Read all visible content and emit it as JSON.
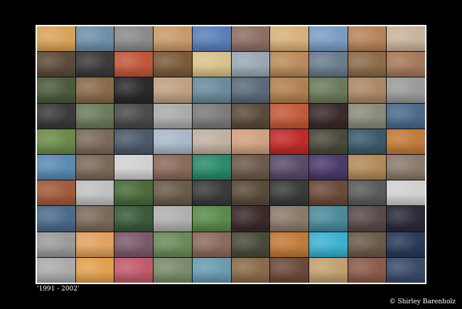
{
  "caption": {
    "years": "'1991 - 2002'",
    "copyright": "© Shirley Barenholz"
  },
  "mosaic": {
    "rows": 10,
    "columns": 10,
    "tile_colors": [
      "#d9a25a",
      "#6f8fa8",
      "#8a8a8a",
      "#c89a6b",
      "#5a7fb8",
      "#8d6e63",
      "#d6b07a",
      "#7a9cc2",
      "#b5835a",
      "#c7b39a",
      "#5b4a3a",
      "#3a3a3a",
      "#c0573a",
      "#7a5a3a",
      "#d8c08a",
      "#9aa7b3",
      "#b88a5a",
      "#6a7b8c",
      "#8c6a4a",
      "#a5785a",
      "#4a5a3a",
      "#8a6a4a",
      "#2a2a2a",
      "#c0a080",
      "#6a8a9a",
      "#5a6a7a",
      "#b08050",
      "#6a7a5a",
      "#aa8866",
      "#9a9a9a",
      "#3a3a3a",
      "#6a7a5a",
      "#4a4a4a",
      "#aaaaaa",
      "#7a7a7a",
      "#5a4a3a",
      "#c05a3a",
      "#3a2a2a",
      "#8a8a7a",
      "#4a6a8a",
      "#6a8a4a",
      "#7a6a5a",
      "#4a5a6a",
      "#a8b8c8",
      "#c0b0a0",
      "#d0a080",
      "#c02a2a",
      "#4a4a3a",
      "#3a5a6a",
      "#c07a3a",
      "#5a8ab0",
      "#7a6a5a",
      "#d0d0d0",
      "#8a6a5a",
      "#2a8a6a",
      "#6a5a4a",
      "#5a4a6a",
      "#4a3a6a",
      "#b08a5a",
      "#8a7a6a",
      "#a05a3a",
      "#c0c0c0",
      "#4a6a3a",
      "#6a5a4a",
      "#3a3a3a",
      "#5a4a3a",
      "#3a3a3a",
      "#6a4a3a",
      "#5a5a5a",
      "#d0d0d0",
      "#4a6a8a",
      "#7a6a5a",
      "#3a5a3a",
      "#b0b0b0",
      "#5a8a4a",
      "#3a2a2a",
      "#8a7a6a",
      "#4a8a9a",
      "#5a4a4a",
      "#2a2a3a",
      "#9a9a9a",
      "#e0a060",
      "#7a5a6a",
      "#6a8a5a",
      "#8a6a5a",
      "#4a4a3a",
      "#c07a3a",
      "#3ab0d0",
      "#6a5a4a",
      "#2a3a5a",
      "#aaaaaa",
      "#e0a050",
      "#c05a6a",
      "#7a8a6a",
      "#6a9ab0",
      "#8a6a4a",
      "#6a4a3a",
      "#c0a070",
      "#8a5a4a",
      "#3a4a6a"
    ]
  }
}
